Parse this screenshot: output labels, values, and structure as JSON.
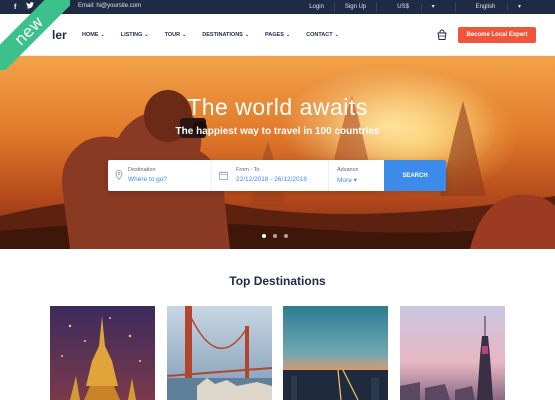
{
  "topbar": {
    "social_icons": [
      "facebook-icon",
      "twitter-icon"
    ],
    "email": "hi@yoursite.com",
    "links": [
      "Login",
      "Sign Up",
      "US$",
      "English"
    ]
  },
  "badge": {
    "label": "new"
  },
  "header": {
    "logo_text": "ler",
    "nav": [
      {
        "label": "HOME"
      },
      {
        "label": "LISTING"
      },
      {
        "label": "TOUR"
      },
      {
        "label": "DESTINATIONS"
      },
      {
        "label": "PAGES"
      },
      {
        "label": "CONTACT"
      }
    ],
    "cta_label": "Become Local Expert"
  },
  "hero": {
    "title": "The world awaits",
    "subtitle": "The happiest way to travel in 100 countries",
    "search": {
      "destination_label": "Destination",
      "destination_placeholder": "Where to go?",
      "date_label": "From - To",
      "date_value": "22/12/2018 - 26/12/2018",
      "advance_label": "Advance",
      "advance_value": "More",
      "button_label": "SEARCH"
    },
    "slides": 3,
    "active_slide": 1
  },
  "section": {
    "title": "Top Destinations",
    "cards": 4
  },
  "colors": {
    "accent_blue": "#3d8be8",
    "cta_orange": "#f0553b",
    "topbar_navy": "#1f2a44",
    "badge_green": "#3cc18d"
  }
}
